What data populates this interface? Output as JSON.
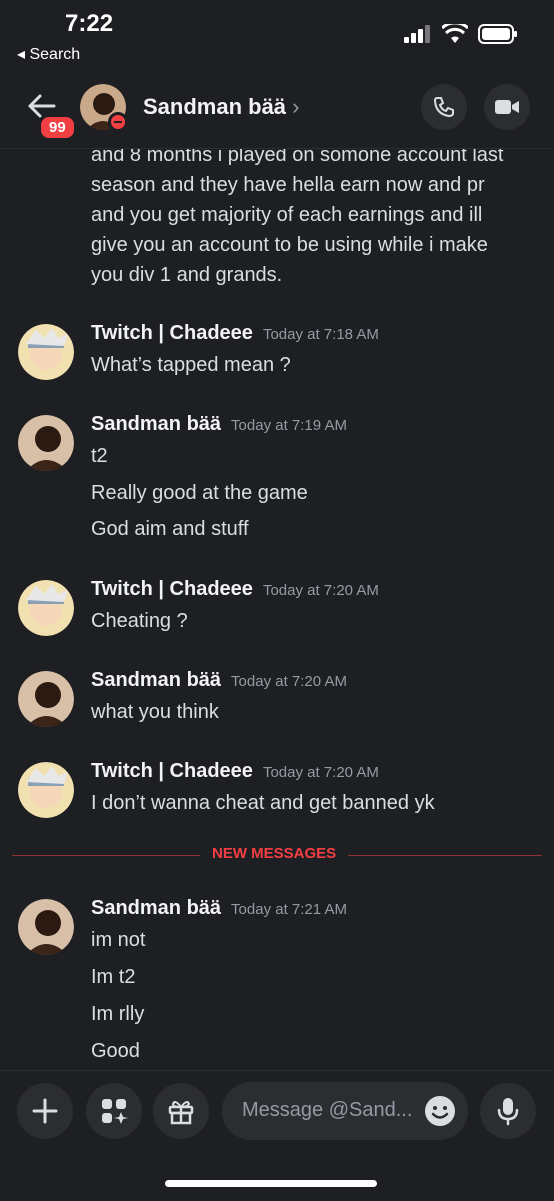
{
  "status": {
    "time": "7:22",
    "back_app": "◂ Search"
  },
  "header": {
    "badge": "99",
    "name": "Sandman bää",
    "chevron": "›"
  },
  "messages": {
    "partial": [
      "and 8 months i played on somone account last",
      "season and they have hella earn now and pr",
      "and you get majority of each earnings and ill",
      "give you an account to be using while i make",
      "you div 1 and grands."
    ],
    "groups": [
      {
        "author": "Twitch | Chadeee",
        "time": "Today at 7:18 AM",
        "lines": [
          "What’s tapped mean ?"
        ]
      },
      {
        "author": "Sandman bää",
        "time": "Today at 7:19 AM",
        "lines": [
          "t2",
          "Really good at the game",
          "God aim and stuff"
        ]
      },
      {
        "author": "Twitch | Chadeee",
        "time": "Today at 7:20 AM",
        "lines": [
          "Cheating ?"
        ]
      },
      {
        "author": "Sandman bää",
        "time": "Today at 7:20 AM",
        "lines": [
          "what you think"
        ]
      },
      {
        "author": "Twitch | Chadeee",
        "time": "Today at 7:20 AM",
        "lines": [
          "I don’t wanna cheat and get banned yk"
        ]
      },
      {
        "author": "Sandman bää",
        "time": "Today at 7:21 AM",
        "lines": [
          "im not",
          "Im t2",
          "Im rlly",
          "Good"
        ]
      }
    ],
    "new_messages_label": "NEW MESSAGES"
  },
  "composer": {
    "placeholder": "Message @Sand..."
  },
  "colors": {
    "bg": "#1e1f22",
    "danger": "#f23f43",
    "muted": "#949ba4",
    "text": "#dbdee1"
  }
}
